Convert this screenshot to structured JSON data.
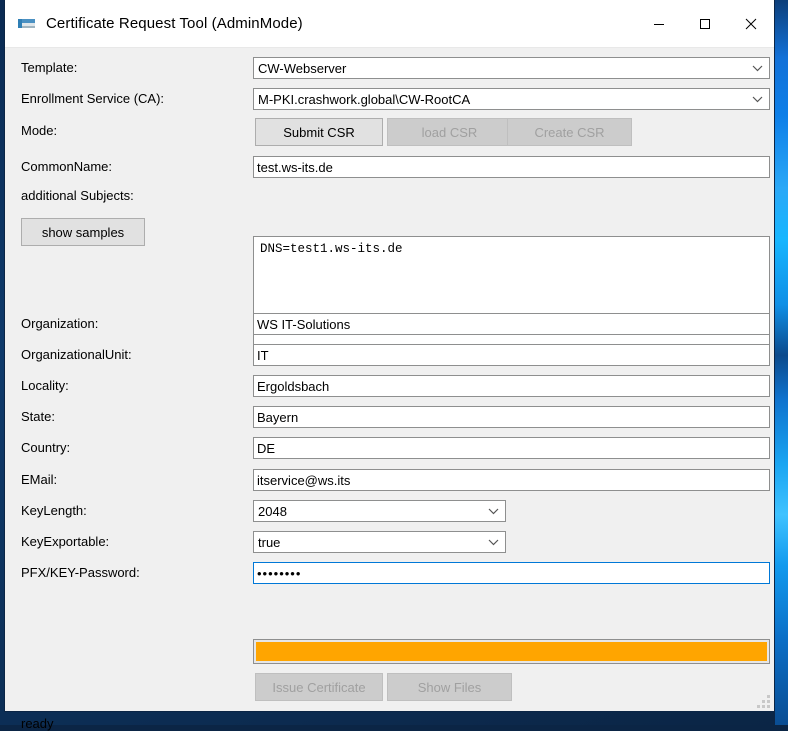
{
  "window": {
    "title": "Certificate Request Tool (AdminMode)",
    "icon": "certificate-icon",
    "controls": {
      "minimize": "minimize-icon",
      "maximize": "maximize-icon",
      "close": "close-icon"
    }
  },
  "form": {
    "template": {
      "label": "Template:",
      "value": "CW-Webserver"
    },
    "enrollment_service": {
      "label": "Enrollment Service (CA):",
      "value": "M-PKI.crashwork.global\\CW-RootCA"
    },
    "mode": {
      "label": "Mode:",
      "buttons": [
        {
          "label": "Submit CSR",
          "disabled": false
        },
        {
          "label": "load CSR",
          "disabled": true
        },
        {
          "label": "Create CSR",
          "disabled": true
        }
      ]
    },
    "common_name": {
      "label": "CommonName:",
      "value": "test.ws-its.de"
    },
    "additional_subjects": {
      "label": "additional Subjects:",
      "value": "DNS=test1.ws-its.de"
    },
    "show_samples": {
      "label": "show samples"
    },
    "organization": {
      "label": "Organization:",
      "value": "WS IT-Solutions"
    },
    "organizational_unit": {
      "label": "OrganizationalUnit:",
      "value": "IT"
    },
    "locality": {
      "label": "Locality:",
      "value": "Ergoldsbach"
    },
    "state": {
      "label": "State:",
      "value": "Bayern"
    },
    "country": {
      "label": "Country:",
      "value": "DE"
    },
    "email": {
      "label": "EMail:",
      "value": "itservice@ws.its"
    },
    "key_length": {
      "label": "KeyLength:",
      "value": "2048"
    },
    "key_exportable": {
      "label": "KeyExportable:",
      "value": "true"
    },
    "password": {
      "label": "PFX/KEY-Password:",
      "value": "••••••••",
      "focused": true
    }
  },
  "progress": {
    "value": 100,
    "color": "#ffa500"
  },
  "actions": [
    {
      "label": "Issue Certificate",
      "disabled": true
    },
    {
      "label": "Show Files",
      "disabled": true
    }
  ],
  "status": {
    "text": "ready"
  }
}
